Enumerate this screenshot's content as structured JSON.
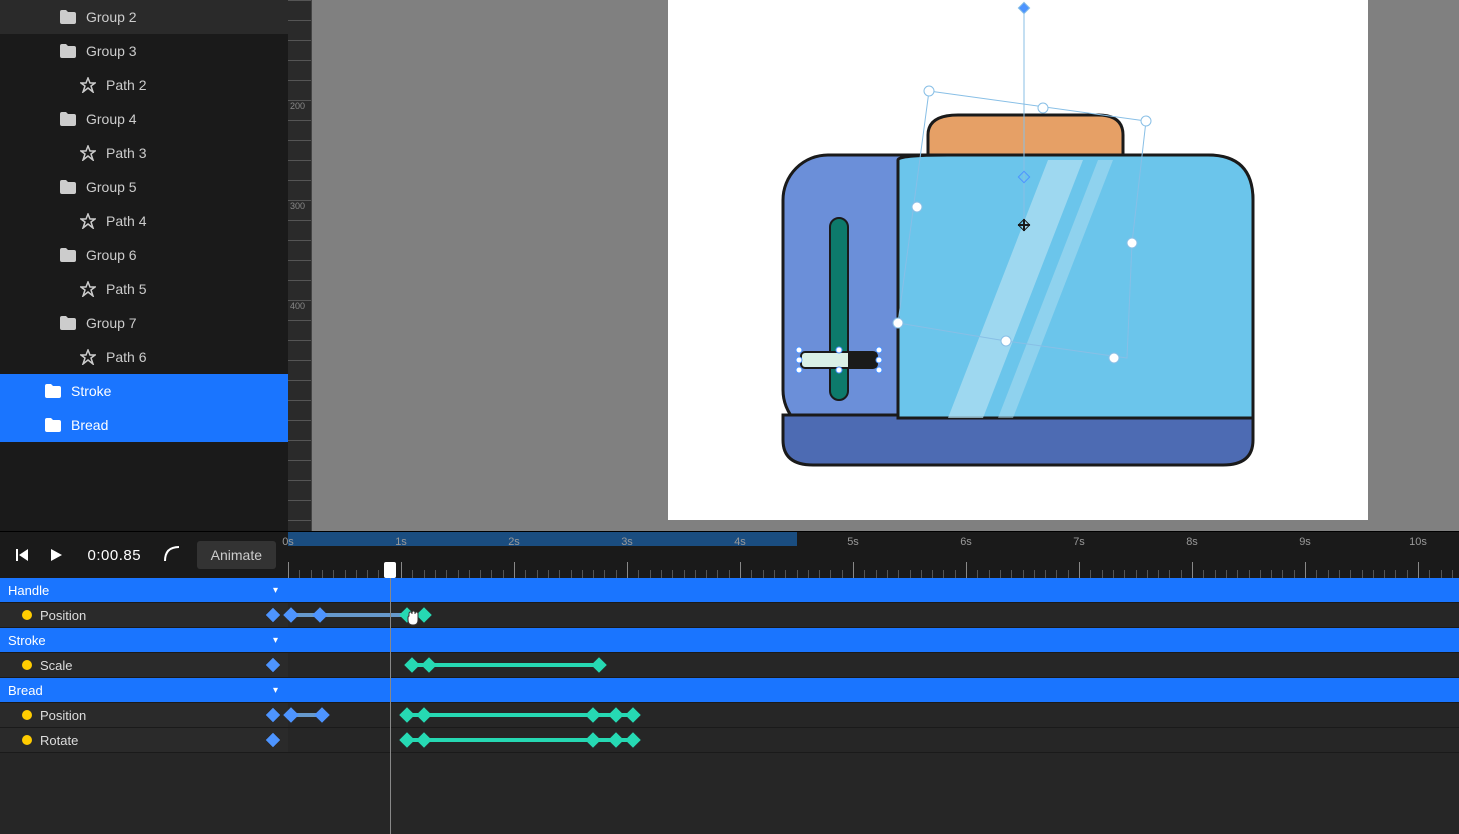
{
  "sidebar": {
    "items": [
      {
        "label": "Group 2",
        "type": "folder",
        "indent": 60,
        "selected": false
      },
      {
        "label": "Group 3",
        "type": "folder",
        "indent": 60,
        "selected": false
      },
      {
        "label": "Path 2",
        "type": "path",
        "indent": 80,
        "selected": false
      },
      {
        "label": "Group 4",
        "type": "folder",
        "indent": 60,
        "selected": false
      },
      {
        "label": "Path 3",
        "type": "path",
        "indent": 80,
        "selected": false
      },
      {
        "label": "Group 5",
        "type": "folder",
        "indent": 60,
        "selected": false
      },
      {
        "label": "Path 4",
        "type": "path",
        "indent": 80,
        "selected": false
      },
      {
        "label": "Group 6",
        "type": "folder",
        "indent": 60,
        "selected": false
      },
      {
        "label": "Path 5",
        "type": "path",
        "indent": 80,
        "selected": false
      },
      {
        "label": "Group 7",
        "type": "folder",
        "indent": 60,
        "selected": false
      },
      {
        "label": "Path 6",
        "type": "path",
        "indent": 80,
        "selected": false
      },
      {
        "label": "Stroke",
        "type": "folder",
        "indent": 45,
        "selected": true
      },
      {
        "label": "Bread",
        "type": "folder",
        "indent": 45,
        "selected": true
      }
    ]
  },
  "transport": {
    "timecode": "0:00.85",
    "animate_label": "Animate"
  },
  "ruler": {
    "labels": [
      "0s",
      "1s",
      "2s",
      "3s",
      "4s",
      "5s",
      "6s",
      "7s",
      "8s",
      "9s",
      "10s"
    ],
    "seconds": 10,
    "pxPerSecond": 113,
    "workarea_end_s": 4.5,
    "playhead_s": 0.9
  },
  "tracks": [
    {
      "type": "header",
      "label": "Handle",
      "caret": true
    },
    {
      "type": "prop",
      "label": "Position",
      "kf_ctrl": true,
      "segments": [
        {
          "from": 0.03,
          "to": 1.2,
          "color": "blue"
        }
      ],
      "keyframes": [
        {
          "t": 0.03,
          "c": "blue"
        },
        {
          "t": 0.28,
          "c": "blue"
        },
        {
          "t": 1.05,
          "c": "teal"
        },
        {
          "t": 1.2,
          "c": "teal"
        }
      ],
      "cursor": true,
      "cursor_t": 1.08
    },
    {
      "type": "header",
      "label": "Stroke",
      "caret": true
    },
    {
      "type": "prop",
      "label": "Scale",
      "kf_ctrl": true,
      "segments": [
        {
          "from": 1.1,
          "to": 2.75,
          "color": "teal"
        }
      ],
      "keyframes": [
        {
          "t": 1.1,
          "c": "teal"
        },
        {
          "t": 1.25,
          "c": "teal"
        },
        {
          "t": 2.75,
          "c": "teal"
        }
      ]
    },
    {
      "type": "header",
      "label": "Bread",
      "caret": true
    },
    {
      "type": "prop",
      "label": "Position",
      "kf_ctrl": true,
      "segments": [
        {
          "from": 0.03,
          "to": 0.3,
          "color": "blue"
        },
        {
          "from": 1.05,
          "to": 3.05,
          "color": "teal"
        }
      ],
      "keyframes": [
        {
          "t": 0.03,
          "c": "blue"
        },
        {
          "t": 0.3,
          "c": "blue"
        },
        {
          "t": 1.05,
          "c": "teal"
        },
        {
          "t": 1.2,
          "c": "teal"
        },
        {
          "t": 2.7,
          "c": "teal"
        },
        {
          "t": 2.9,
          "c": "teal"
        },
        {
          "t": 3.05,
          "c": "teal"
        }
      ]
    },
    {
      "type": "prop",
      "label": "Rotate",
      "kf_ctrl": true,
      "segments": [
        {
          "from": 1.05,
          "to": 3.05,
          "color": "teal"
        }
      ],
      "keyframes": [
        {
          "t": 1.05,
          "c": "teal"
        },
        {
          "t": 1.2,
          "c": "teal"
        },
        {
          "t": 2.7,
          "c": "teal"
        },
        {
          "t": 2.9,
          "c": "teal"
        },
        {
          "t": 3.05,
          "c": "teal"
        }
      ]
    }
  ],
  "ruler_v_marks": [
    200,
    300,
    400
  ],
  "canvas": {
    "toaster": {
      "body": "#6b8fd9",
      "front": "#6bc5eb",
      "base": "#4d6bb3",
      "slot": "#0d7a6b",
      "handle": "#d9f0e6",
      "bread": "#e6a066",
      "bread_dark": "#cc7a33",
      "highlight": "#b3e0f2"
    }
  }
}
